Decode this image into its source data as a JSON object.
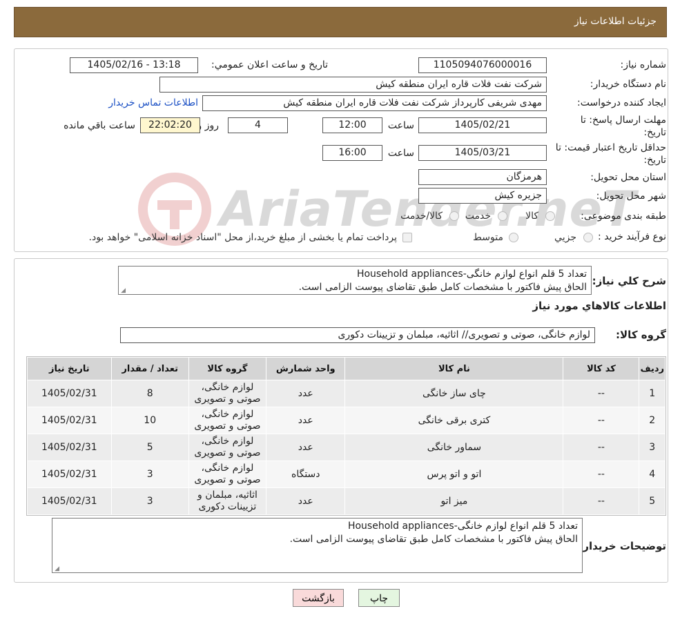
{
  "header": {
    "title": "جزئیات اطلاعات نیاز"
  },
  "form": {
    "need_number_label": "شماره نیاز:",
    "need_number": "1105094076000016",
    "announce_label": "تاریخ و ساعت اعلان عمومي:",
    "announce_value": "1405/02/16 - 13:18",
    "buyer_org_label": "نام دستگاه خریدار:",
    "buyer_org": "شرکت نفت فلات قاره ایران منطقه کیش",
    "creator_label": "ایجاد کننده درخواست:",
    "creator": "مهدی شریفی کارپرداز شرکت نفت فلات قاره ایران منطقه کیش",
    "contact_link": "اطلاعات تماس خریدار",
    "reply_deadline_label_1": "مهلت ارسال پاسخ: تا",
    "reply_deadline_label_2": "تاریخ:",
    "reply_date": "1405/02/21",
    "time_label": "ساعت",
    "reply_time": "12:00",
    "days_value": "4",
    "days_label": "روز و",
    "remaining_time": "22:02:20",
    "remaining_label": "ساعت باقي مانده",
    "price_validity_label_1": "حداقل تاریخ اعتبار قیمت: تا",
    "price_validity_label_2": "تاریخ:",
    "price_validity_date": "1405/03/21",
    "price_validity_time": "16:00",
    "province_label": "استان محل تحویل:",
    "province": "هرمزگان",
    "city_label": "شهر محل تحویل:",
    "city": "جزیره کیش",
    "category_label": "طبقه بندی موضوعی:",
    "category_options": [
      "کالا",
      "خدمت",
      "کالا/خدمت"
    ],
    "process_label": "نوع فرآیند خرید :",
    "process_options": [
      "جزیي",
      "متوسط"
    ],
    "process_note": "پرداخت تمام یا بخشی از مبلغ خرید،از محل \"اسناد خزانه اسلامی\" خواهد بود."
  },
  "summary": {
    "label": "شرح کلي نیاز:",
    "line1": "تعداد 5 قلم انواع لوازم خانگی-Household appliances",
    "line2": "الحاق پیش فاکتور با مشخصات کامل طبق تقاضای پیوست الزامی است."
  },
  "goods_info_title": "اطلاعات کالاهاي مورد نیاز",
  "goods_group": {
    "label": "گروه کالا:",
    "value": "لوازم خانگی، صوتی و تصویری// اثاثیه، مبلمان و تزیینات دکوری"
  },
  "table": {
    "headers": [
      "ردیف",
      "کد کالا",
      "نام کالا",
      "واحد شمارش",
      "گروه کالا",
      "تعداد / مقدار",
      "تاریخ نیاز"
    ],
    "rows": [
      {
        "idx": "1",
        "code": "--",
        "name": "چای ساز خانگی",
        "unit": "عدد",
        "group1": "لوازم خانگی،",
        "group2": "صوتی و تصویری",
        "qty": "8",
        "date": "1405/02/31"
      },
      {
        "idx": "2",
        "code": "--",
        "name": "کتری برقی خانگی",
        "unit": "عدد",
        "group1": "لوازم خانگی،",
        "group2": "صوتی و تصویری",
        "qty": "10",
        "date": "1405/02/31"
      },
      {
        "idx": "3",
        "code": "--",
        "name": "سماور خانگی",
        "unit": "عدد",
        "group1": "لوازم خانگی،",
        "group2": "صوتی و تصویری",
        "qty": "5",
        "date": "1405/02/31"
      },
      {
        "idx": "4",
        "code": "--",
        "name": "اتو و اتو پرس",
        "unit": "دستگاه",
        "group1": "لوازم خانگی،",
        "group2": "صوتی و تصویری",
        "qty": "3",
        "date": "1405/02/31"
      },
      {
        "idx": "5",
        "code": "--",
        "name": "میز اتو",
        "unit": "عدد",
        "group1": "اثاثیه، مبلمان و",
        "group2": "تزیینات دکوری",
        "qty": "3",
        "date": "1405/02/31"
      }
    ]
  },
  "buyer_notes": {
    "label": "توضیحات خریدار:",
    "line1": "تعداد 5 قلم انواع لوازم خانگی-Household appliances",
    "line2": "الحاق پیش فاکتور با مشخصات کامل طبق تقاضای پیوست الزامی است."
  },
  "buttons": {
    "print": "چاپ",
    "back": "بازگشت"
  },
  "watermark": "AriaTender.neT",
  "colors": {
    "header": "#8b6a3c",
    "link": "#1a4fc4",
    "highlight": "#fff7cf",
    "back_button": "#f9dada",
    "print_button": "#e4f6e0"
  }
}
